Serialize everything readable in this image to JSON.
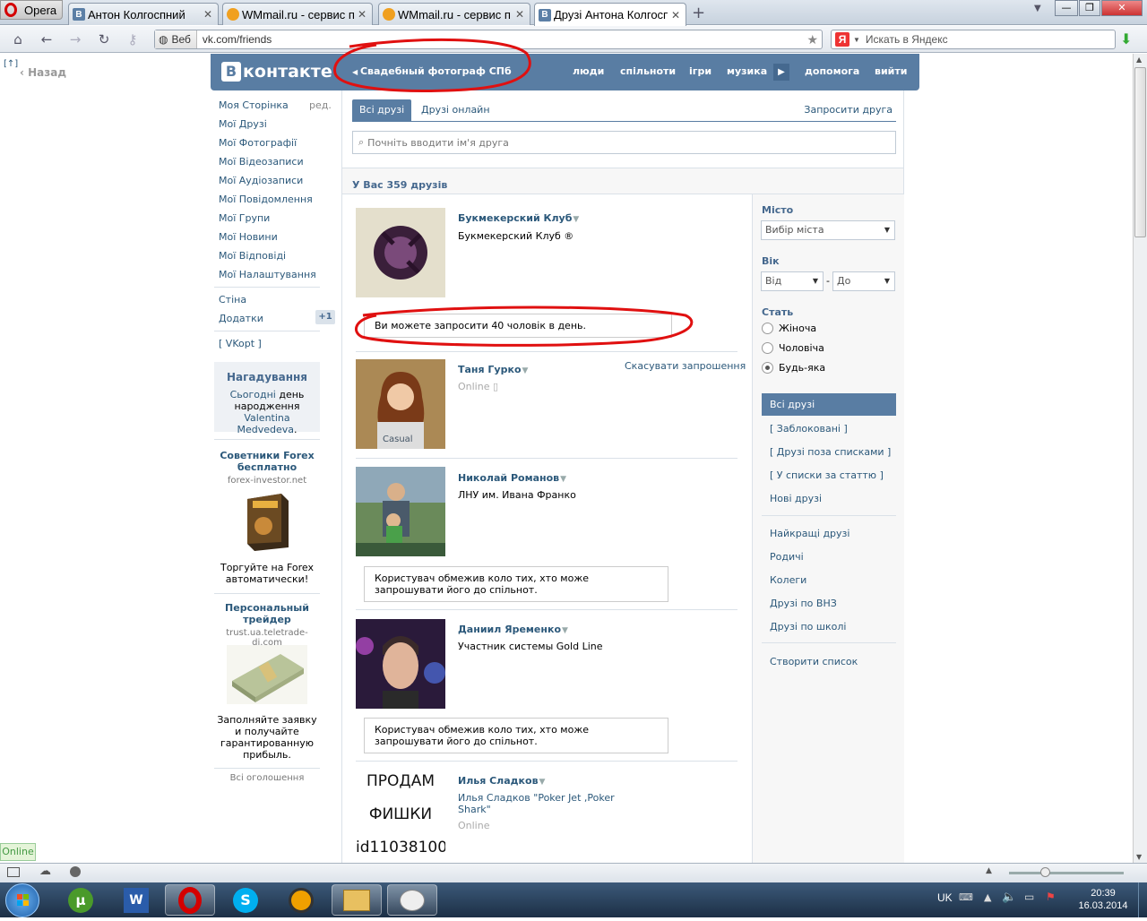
{
  "browser": {
    "menu_label": "Opera",
    "tabs": [
      {
        "label": "Антон Колгоспний",
        "icon": "vk-icon"
      },
      {
        "label": "WMmail.ru - сервис п...",
        "icon": "wmmail-icon"
      },
      {
        "label": "WMmail.ru - сервис п...",
        "icon": "wmmail-icon"
      },
      {
        "label": "Друзі Антона Колгосп...",
        "icon": "vk-icon"
      }
    ],
    "web_label": "Веб",
    "url": "vk.com/friends",
    "search_placeholder": "Искать в Яндекс",
    "back_label": "Назад",
    "panel_toggle": "[↑]"
  },
  "vk": {
    "logo_text": "контакте",
    "logo_letter": "В",
    "back_link": "Свадебный фотограф СПб",
    "nav": [
      "люди",
      "спільноти",
      "ігри",
      "музика",
      "допомога",
      "вийти"
    ]
  },
  "left_menu": {
    "items": [
      "Моя Сторінка",
      "Мої Друзі",
      "Мої Фотографії",
      "Мої Відеозаписи",
      "Мої Аудіозаписи",
      "Мої Повідомлення",
      "Мої Групи",
      "Мої Новини",
      "Мої Відповіді",
      "Мої Налаштування"
    ],
    "edit_label": "ред.",
    "wall": "Стіна",
    "apps": "Додатки",
    "apps_badge": "+1",
    "vkopt": "[ VKopt ]"
  },
  "reminder": {
    "title": "Нагадування",
    "today": "Сьогодні",
    "text": "день народження",
    "name": "Valentina Medvedeva",
    "dot": "."
  },
  "ads": [
    {
      "title": "Советники Forex бесплатно",
      "domain": "forex-investor.net",
      "text": "Торгуйте на Forex автоматически!"
    },
    {
      "title": "Персональный трейдер",
      "domain": "trust.ua.teletrade-dj.com",
      "text": "Заполняйте заявку и получайте гарантированную прибыль."
    }
  ],
  "ads_all": "Всі оголошення",
  "friends": {
    "tabs": [
      "Всі друзі",
      "Друзі онлайн"
    ],
    "invite": "Запросити друга",
    "search_placeholder": "Почніть вводити ім'я друга",
    "count_text": "У Вас 359 друзів",
    "list": [
      {
        "name": "Букмекерский Клуб",
        "sub": "Букмекерский Клуб ®"
      },
      {
        "name": "Таня Гурко",
        "status": "Online",
        "action": "Скасувати запрошення"
      },
      {
        "name": "Николай Романов",
        "sub": "ЛНУ им. Ивана Франко"
      },
      {
        "name": "Даниил Яременко",
        "sub": "Участник системы Gold Line"
      },
      {
        "name": "Илья Сладков",
        "sub": "Илья Сладков \"Poker Jet ,Poker Shark\"",
        "status": "Online",
        "photo_lines": [
          "ПРОДАМ",
          "ФИШКИ",
          "id11038100"
        ]
      }
    ],
    "invite_limit": "Ви можете запросити 40 чоловік в день.",
    "restricted": "Користувач обмежив коло тих, хто може запрошувати його до спільнот."
  },
  "filters": {
    "city_label": "Місто",
    "city_placeholder": "Вибір міста",
    "age_label": "Вік",
    "age_from": "Від",
    "age_dash": "-",
    "age_to": "До",
    "sex_label": "Стать",
    "sex_options": [
      "Жіноча",
      "Чоловіча",
      "Будь-яка"
    ],
    "sex_selected": "Будь-яка",
    "lists": [
      "Всі друзі",
      "[ Заблоковані ]",
      "[ Друзі поза списками ]",
      "[ У списки за статтю ]",
      "Нові друзі"
    ],
    "lists2": [
      "Найкращі друзі",
      "Родичі",
      "Колеги",
      "Друзі по ВНЗ",
      "Друзі по школі"
    ],
    "create": "Створити список"
  },
  "status_bar": {
    "online_badge": "Online"
  },
  "taskbar": {
    "lang": "UK",
    "time": "20:39",
    "date": "16.03.2014"
  }
}
